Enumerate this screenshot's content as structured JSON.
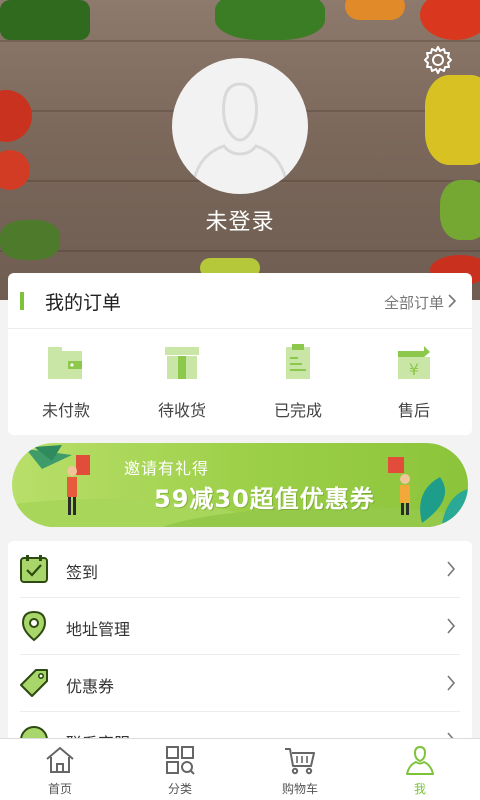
{
  "header": {
    "login_status": "未登录",
    "settings_icon": "gear-icon",
    "avatar_icon": "default-avatar-icon"
  },
  "orders": {
    "title": "我的订单",
    "view_all": "全部订单",
    "items": [
      {
        "label": "未付款",
        "icon": "wallet-icon"
      },
      {
        "label": "待收货",
        "icon": "package-icon"
      },
      {
        "label": "已完成",
        "icon": "receipt-icon"
      },
      {
        "label": "售后",
        "icon": "refund-icon"
      }
    ]
  },
  "banner": {
    "line1": "邀请有礼得",
    "line2": "59减30超值优惠券"
  },
  "menu": {
    "items": [
      {
        "label": "签到",
        "icon": "calendar-check-icon"
      },
      {
        "label": "地址管理",
        "icon": "location-pin-icon"
      },
      {
        "label": "优惠券",
        "icon": "coupon-tag-icon"
      },
      {
        "label": "联系客服",
        "icon": "customer-service-icon"
      }
    ]
  },
  "tabbar": {
    "items": [
      {
        "label": "首页",
        "icon": "home-icon"
      },
      {
        "label": "分类",
        "icon": "category-icon"
      },
      {
        "label": "购物车",
        "icon": "cart-icon"
      },
      {
        "label": "我",
        "icon": "user-icon",
        "active": true
      }
    ]
  },
  "colors": {
    "accent": "#7cc33a",
    "header_bg": "#7b685b"
  }
}
